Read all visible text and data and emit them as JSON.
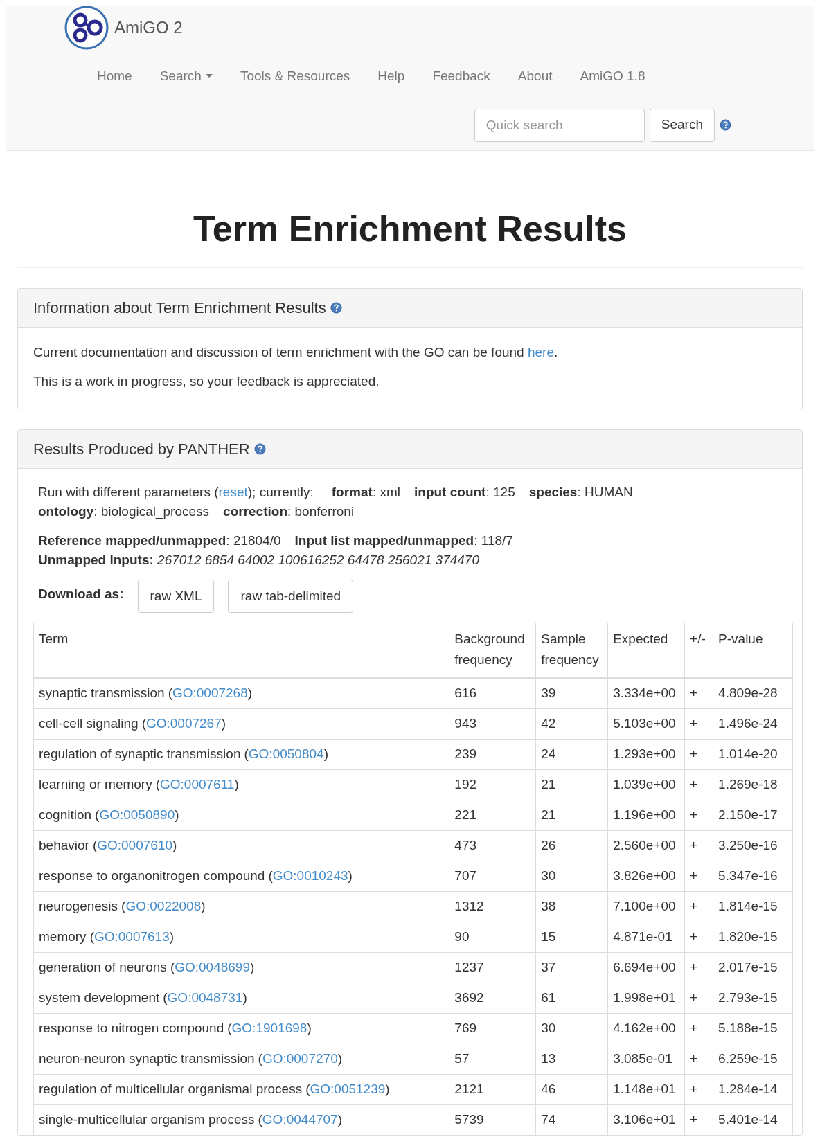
{
  "brand": "AmiGO 2",
  "nav": [
    {
      "label": "Home",
      "dropdown": false
    },
    {
      "label": "Search",
      "dropdown": true
    },
    {
      "label": "Tools & Resources",
      "dropdown": false
    },
    {
      "label": "Help",
      "dropdown": false
    },
    {
      "label": "Feedback",
      "dropdown": false
    },
    {
      "label": "About",
      "dropdown": false
    },
    {
      "label": "AmiGO 1.8",
      "dropdown": false
    }
  ],
  "quick_search": {
    "placeholder": "Quick search",
    "button": "Search"
  },
  "title": "Term Enrichment Results",
  "info_panel": {
    "heading": "Information about Term Enrichment Results",
    "doc_text": "Current documentation and discussion of term enrichment with the GO can be found ",
    "doc_link": "here",
    "doc_end": ".",
    "note": "This is a work in progress, so your feedback is appreciated."
  },
  "results_panel": {
    "heading": "Results Produced by PANTHER",
    "run_text": "Run with different parameters (",
    "run_link": "reset",
    "run_end": "); currently:",
    "params": [
      [
        "**format**: xml",
        "**input count**: 125",
        "**species**: HUMAN"
      ],
      [
        "**ontology**: biological_process",
        "**correction**: bonferroni"
      ]
    ],
    "mapping": [
      "**Reference mapped/unmapped**: 21804/0",
      "**Input list mapped/unmapped**: 118/7"
    ],
    "unmapped": "**Unmapped inputs:** *267012 6854 64002 100616252 64478 256021 374470*",
    "download_label": "Download as:",
    "download_buttons": [
      "raw XML",
      "raw tab-delimited"
    ],
    "table": {
      "columns": [
        "Term",
        "Background frequency",
        "Sample frequency",
        "Expected",
        "+/-",
        "P-value"
      ],
      "rows": [
        {
          "term": "synaptic transmission",
          "go_ref": "(GO:0007268)",
          "background": "616",
          "sample": "39",
          "expected": "3.334e+00",
          "sign": "+",
          "p_value": "4.809e-28"
        },
        {
          "term": "cell-cell signaling",
          "go_ref": "(GO:0007267)",
          "background": "943",
          "sample": "42",
          "expected": "5.103e+00",
          "sign": "+",
          "p_value": "1.496e-24"
        },
        {
          "term": "regulation of synaptic transmission",
          "go_ref": "(GO:0050804)",
          "background": "239",
          "sample": "24",
          "expected": "1.293e+00",
          "sign": "+",
          "p_value": "1.014e-20"
        },
        {
          "term": "learning or memory",
          "go_ref": "(GO:0007611)",
          "background": "192",
          "sample": "21",
          "expected": "1.039e+00",
          "sign": "+",
          "p_value": "1.269e-18"
        },
        {
          "term": "cognition",
          "go_ref": "(GO:0050890)",
          "background": "221",
          "sample": "21",
          "expected": "1.196e+00",
          "sign": "+",
          "p_value": "2.150e-17"
        },
        {
          "term": "behavior",
          "go_ref": "(GO:0007610)",
          "background": "473",
          "sample": "26",
          "expected": "2.560e+00",
          "sign": "+",
          "p_value": "3.250e-16"
        },
        {
          "term": "response to organonitrogen compound",
          "go_ref": "(GO:0010243)",
          "background": "707",
          "sample": "30",
          "expected": "3.826e+00",
          "sign": "+",
          "p_value": "5.347e-16"
        },
        {
          "term": "neurogenesis",
          "go_ref": "(GO:0022008)",
          "background": "1312",
          "sample": "38",
          "expected": "7.100e+00",
          "sign": "+",
          "p_value": "1.814e-15"
        },
        {
          "term": "memory",
          "go_ref": "(GO:0007613)",
          "background": "90",
          "sample": "15",
          "expected": "4.871e-01",
          "sign": "+",
          "p_value": "1.820e-15"
        },
        {
          "term": "generation of neurons",
          "go_ref": "(GO:0048699)",
          "background": "1237",
          "sample": "37",
          "expected": "6.694e+00",
          "sign": "+",
          "p_value": "2.017e-15"
        },
        {
          "term": "system development",
          "go_ref": "(GO:0048731)",
          "background": "3692",
          "sample": "61",
          "expected": "1.998e+01",
          "sign": "+",
          "p_value": "2.793e-15"
        },
        {
          "term": "response to nitrogen compound",
          "go_ref": "(GO:1901698)",
          "background": "769",
          "sample": "30",
          "expected": "4.162e+00",
          "sign": "+",
          "p_value": "5.188e-15"
        },
        {
          "term": "neuron-neuron synaptic transmission",
          "go_ref": "(GO:0007270)",
          "background": "57",
          "sample": "13",
          "expected": "3.085e-01",
          "sign": "+",
          "p_value": "6.259e-15"
        },
        {
          "term": "regulation of multicellular organismal process",
          "go_ref": "(GO:0051239)",
          "background": "2121",
          "sample": "46",
          "expected": "1.148e+01",
          "sign": "+",
          "p_value": "1.284e-14"
        },
        {
          "term": "single-multicellular organism process",
          "go_ref": "(GO:0044707)",
          "background": "5739",
          "sample": "74",
          "expected": "3.106e+01",
          "sign": "+",
          "p_value": "5.401e-14"
        }
      ]
    }
  }
}
